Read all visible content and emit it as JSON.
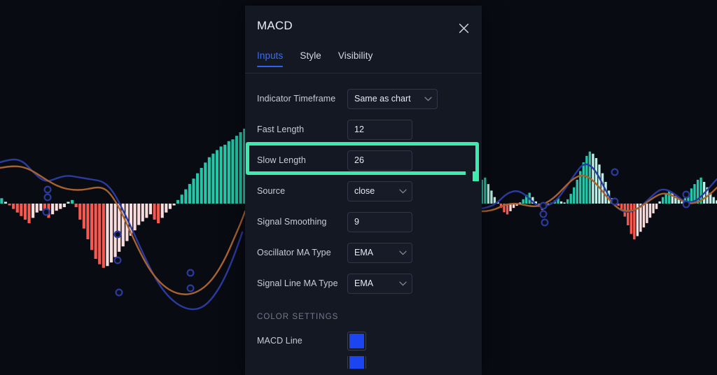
{
  "window": {
    "background_color": "#080b12"
  },
  "panel": {
    "title": "MACD",
    "background_color": "#141823",
    "close_icon": "close-icon",
    "tabs": [
      {
        "label": "Inputs",
        "active": true
      },
      {
        "label": "Style",
        "active": false
      },
      {
        "label": "Visibility",
        "active": false
      }
    ],
    "active_tab_color": "#3b6ef0",
    "fields": [
      {
        "label": "Indicator Timeframe",
        "value": "Same as chart",
        "type": "select",
        "width": "wide"
      },
      {
        "label": "Fast Length",
        "value": "12",
        "type": "number"
      },
      {
        "label": "Slow Length",
        "value": "26",
        "type": "number",
        "highlighted": true
      },
      {
        "label": "Source",
        "value": "close",
        "type": "select"
      },
      {
        "label": "Signal Smoothing",
        "value": "9",
        "type": "number"
      },
      {
        "label": "Oscillator MA Type",
        "value": "EMA",
        "type": "select"
      },
      {
        "label": "Signal Line MA Type",
        "value": "EMA",
        "type": "select"
      }
    ],
    "color_settings": {
      "section_label": "COLOR SETTINGS",
      "rows": [
        {
          "label": "MACD Line",
          "color": "#1b45f0"
        },
        {
          "label": "",
          "color": "#1b45f0"
        }
      ]
    }
  },
  "annotation": {
    "type": "highlight-rectangle",
    "target_field": "Slow Length",
    "color": "#3cecac"
  },
  "chart_data": {
    "type": "bar",
    "title": "",
    "xlabel": "",
    "ylabel": "",
    "grid": false,
    "legend": null,
    "indicator": "MACD",
    "colors": {
      "histogram_up_strong": "#26c6a8",
      "histogram_up_weak": "#bdf0e6",
      "histogram_down_strong": "#f9584f",
      "histogram_down_weak": "#f9dcdc",
      "macd_line": "#2b3a9e",
      "signal_line": "#a8622f",
      "marker": "#2b3a9e"
    },
    "zero_line_y": 291,
    "series": [
      {
        "name": "Histogram (left pane)",
        "type": "bar",
        "values": [
          2,
          3,
          1,
          -1,
          -3,
          -5,
          -7,
          -9,
          -11,
          -8,
          -5,
          -4,
          -6,
          -8,
          -6,
          -4,
          -3,
          -2,
          1,
          2,
          -2,
          -9,
          -14,
          -20,
          -26,
          -31,
          -34,
          -36,
          -35,
          -33,
          -30,
          -27,
          -24,
          -21,
          -18,
          -15,
          -12,
          -10,
          -8,
          -6,
          -9,
          -11,
          -8,
          -5,
          -3,
          -1,
          2,
          5,
          8,
          11,
          14,
          17,
          20,
          23,
          26,
          28,
          30,
          32,
          33,
          35,
          36,
          38,
          40,
          42
        ]
      },
      {
        "name": "Histogram (right pane)",
        "type": "bar",
        "values": [
          22,
          24,
          18,
          12,
          6,
          2,
          -4,
          -8,
          -10,
          -7,
          -4,
          -2,
          1,
          4,
          8,
          10,
          6,
          2,
          -3,
          -6,
          -4,
          -1,
          1,
          3,
          5,
          2,
          1,
          4,
          9,
          15,
          22,
          30,
          38,
          44,
          48,
          46,
          42,
          36,
          28,
          20,
          12,
          5,
          1,
          -2,
          -5,
          -12,
          -20,
          -28,
          -33,
          -30,
          -26,
          -22,
          -18,
          -13,
          -9,
          -5,
          2,
          6,
          9,
          12,
          10,
          7,
          4,
          2,
          5,
          9,
          14,
          18,
          22,
          24,
          20,
          15,
          10,
          6,
          3
        ]
      },
      {
        "name": "MACD Line",
        "type": "line",
        "color": "#2b3a9e"
      },
      {
        "name": "Signal Line",
        "type": "line",
        "color": "#a8622f"
      }
    ]
  }
}
